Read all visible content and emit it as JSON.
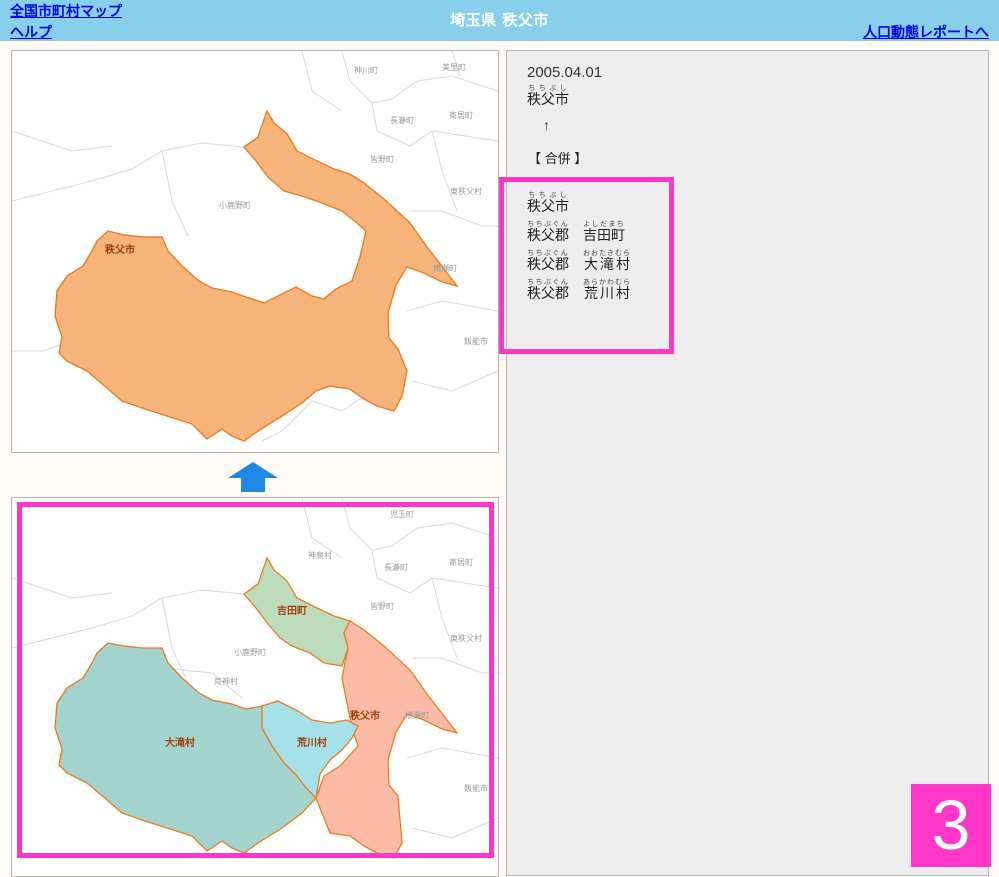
{
  "header": {
    "national_map_link": "全国市町村マップ",
    "help_link": "ヘルプ",
    "title": "埼玉県 秩父市",
    "report_link": "人口動態レポートへ"
  },
  "map_current": {
    "city_label": "秩父市",
    "neighbor_labels": [
      "神川町",
      "美里町",
      "長瀞町",
      "寄居町",
      "皆野町",
      "小鹿野町",
      "東秩父村",
      "横瀬町",
      "飯能市"
    ],
    "fill_color": "#f6b47a"
  },
  "map_previous": {
    "labels": {
      "yoshida": "吉田町",
      "otaki": "大滝村",
      "arakawa": "荒川村",
      "chichibu": "秩父市"
    },
    "neighbor_labels": [
      "児玉町",
      "神泉村",
      "長瀞町",
      "寄居町",
      "皆野町",
      "小鹿野町",
      "両神村",
      "東秩父村",
      "横瀬町",
      "飯能市"
    ],
    "colors": {
      "yoshida": "#bcdcbc",
      "otaki": "#a3d4ce",
      "arakawa": "#a6e0e8",
      "chichibu": "#fbbba6"
    }
  },
  "info": {
    "date": "2005.04.01",
    "new_city": {
      "kanji": "秩父市",
      "reading": "ちちぶし"
    },
    "arrow": "↑",
    "event": "【 合併 】",
    "sources": [
      {
        "district_kanji": "",
        "district_reading": "",
        "name_kanji": "秩父市",
        "name_reading": "ちちぶし"
      },
      {
        "district_kanji": "秩父郡",
        "district_reading": "ちちぶぐん",
        "name_kanji": "吉田町",
        "name_reading": "よしだまち"
      },
      {
        "district_kanji": "秩父郡",
        "district_reading": "ちちぶぐん",
        "name_kanji": "大滝村",
        "name_reading": "おおたきむら"
      },
      {
        "district_kanji": "秩父郡",
        "district_reading": "ちちぶぐん",
        "name_kanji": "荒川村",
        "name_reading": "あらかわむら"
      }
    ]
  },
  "arrow_color": "#1e88e5",
  "highlight_color": "#ff36c8",
  "step_badge": "3"
}
